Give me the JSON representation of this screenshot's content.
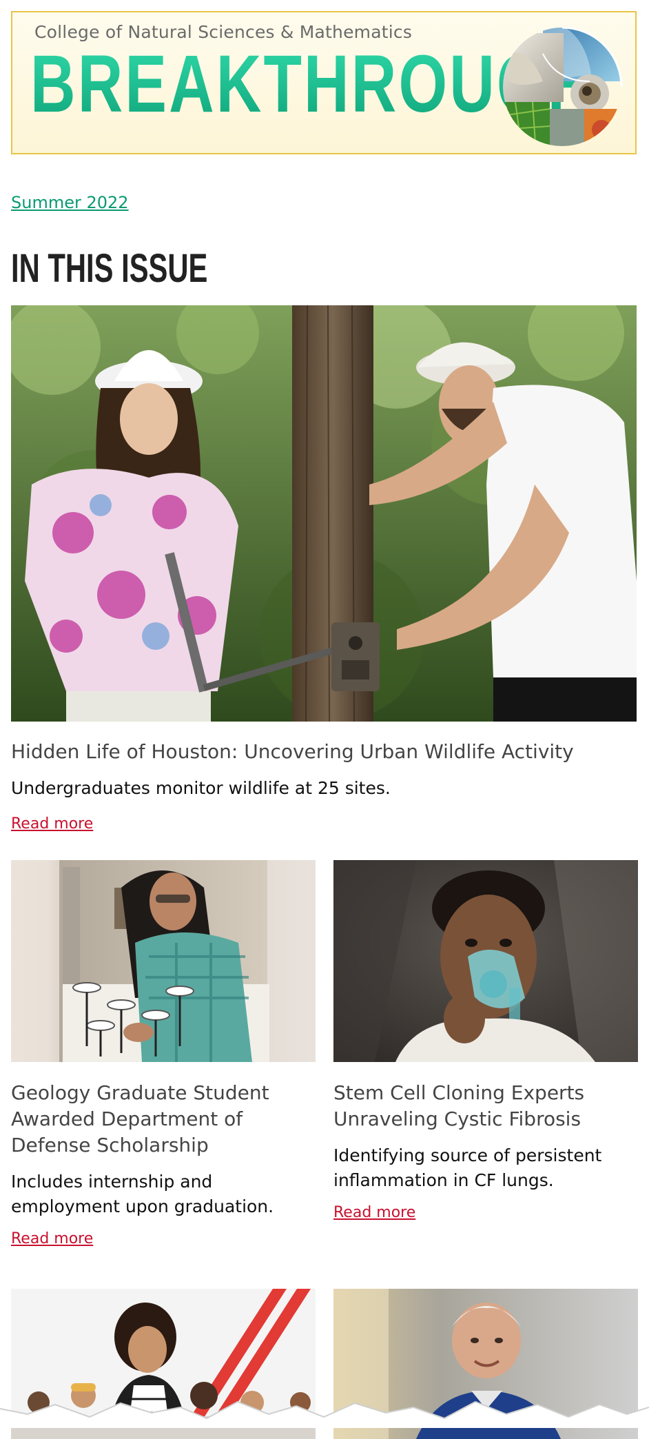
{
  "header": {
    "college": "College of Natural Sciences & Mathematics",
    "title": "BREAKTHROUGH"
  },
  "issue": {
    "label": "Summer 2022"
  },
  "section": {
    "heading": "IN THIS ISSUE"
  },
  "feature": {
    "title": "Hidden Life of Houston: Uncovering Urban Wildlife Activity",
    "summary": "Undergraduates monitor wildlife at 25 sites.",
    "read_more": "Read more"
  },
  "cards": [
    {
      "title": "Geology Graduate Student Awarded Department of Defense Scholarship",
      "summary": "Includes internship and employment upon graduation.",
      "read_more": "Read more"
    },
    {
      "title": "Stem Cell Cloning Experts Unraveling Cystic Fibrosis",
      "summary": "Identifying source of persistent inflammation in CF lungs.",
      "read_more": "Read more"
    }
  ],
  "colors": {
    "accent_green": "#19b88c",
    "link_red": "#c8102e",
    "banner_border": "#e8c547"
  }
}
